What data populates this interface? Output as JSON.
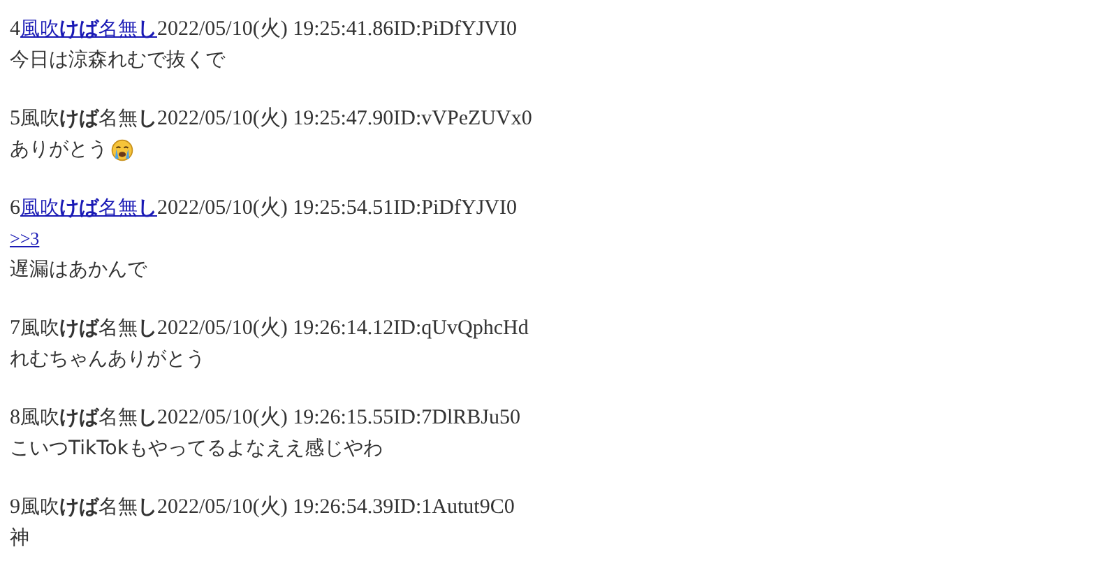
{
  "posts": [
    {
      "number": "4",
      "name": "風吹**けば**名無**し**",
      "name_linked": true,
      "date": "2022/05/10(火) 19:25:41.86",
      "id": "ID:PiDfYJVI0",
      "body": [
        {
          "kind": "text",
          "text": "今日は涼森れむで抜くで"
        }
      ]
    },
    {
      "number": "5",
      "name": "風吹**けば**名無**し**",
      "name_linked": false,
      "date": "2022/05/10(火) 19:25:47.90",
      "id": "ID:vVPeZUVx0",
      "body": [
        {
          "kind": "emoji-text",
          "text": "ありがとう"
        }
      ]
    },
    {
      "number": "6",
      "name": "風吹**けば**名無**し**",
      "name_linked": true,
      "date": "2022/05/10(火) 19:25:54.51",
      "id": "ID:PiDfYJVI0",
      "body": [
        {
          "kind": "anchor",
          "text": ">>3"
        },
        {
          "kind": "text",
          "text": "遅漏はあかんで"
        }
      ]
    },
    {
      "number": "7",
      "name": "風吹**けば**名無**し**",
      "name_linked": false,
      "date": "2022/05/10(火) 19:26:14.12",
      "id": "ID:qUvQphcHd",
      "body": [
        {
          "kind": "text",
          "text": "れむちゃんありがとう"
        }
      ]
    },
    {
      "number": "8",
      "name": "風吹**けば**名無**し**",
      "name_linked": false,
      "date": "2022/05/10(火) 19:26:15.55",
      "id": "ID:7DlRBJu50",
      "body": [
        {
          "kind": "text",
          "text": "こいつTikTokもやってるよなええ感じやわ"
        }
      ]
    },
    {
      "number": "9",
      "name": "風吹**けば**名無**し**",
      "name_linked": false,
      "date": "2022/05/10(火) 19:26:54.39",
      "id": "ID:1Autut9C0",
      "body": [
        {
          "kind": "text",
          "text": "神"
        }
      ]
    }
  ]
}
